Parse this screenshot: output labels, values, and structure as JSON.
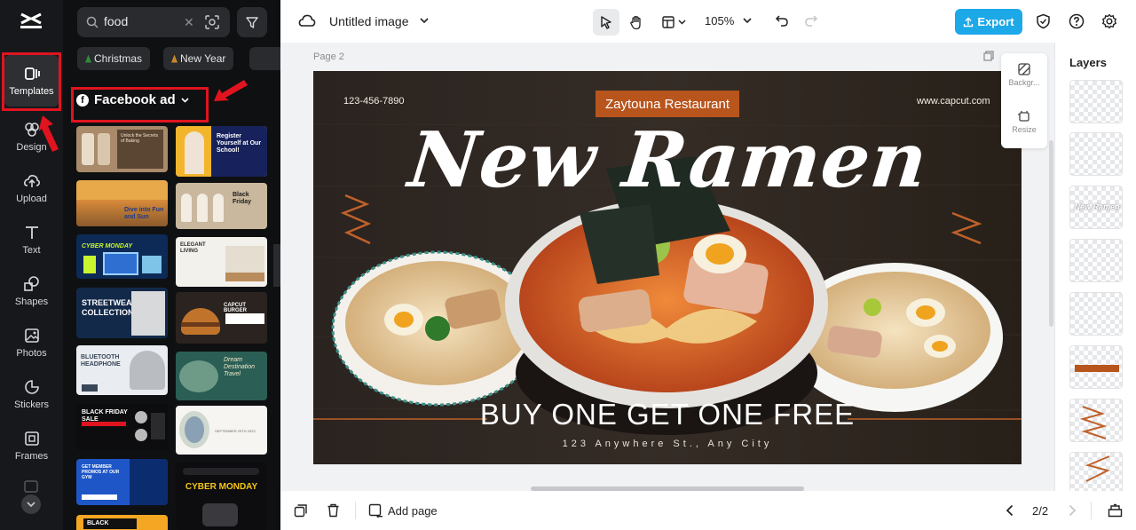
{
  "rail": {
    "items": [
      {
        "label": "Templates",
        "icon": "templates-icon"
      },
      {
        "label": "Design",
        "icon": "design-icon"
      },
      {
        "label": "Upload",
        "icon": "upload-icon"
      },
      {
        "label": "Text",
        "icon": "text-icon"
      },
      {
        "label": "Shapes",
        "icon": "shapes-icon"
      },
      {
        "label": "Photos",
        "icon": "photos-icon"
      },
      {
        "label": "Stickers",
        "icon": "stickers-icon"
      },
      {
        "label": "Frames",
        "icon": "frames-icon"
      }
    ]
  },
  "panel": {
    "search_value": "food",
    "chips": [
      "Christmas",
      "New Year"
    ],
    "category": "Facebook ad",
    "thumbnails": [
      "Unlock the Secrets of Baking",
      "Register Yourself at Our School!",
      "Dive into Fun and Sun",
      "Black Friday",
      "CYBER MONDAY",
      "ELEGANT LIVING",
      "STREETWEAR COLLECTION",
      "CAPCUT BURGER",
      "BLUETOOTH HEADPHONE",
      "Dream Destination Travel",
      "BLACK FRIDAY SALE",
      "SEPTEMBER 29TH 2023",
      "GET MEMBER PROMOS AT OUR GYM",
      "CYBER MONDAY",
      "BLACK"
    ]
  },
  "topbar": {
    "doc_title": "Untitled image",
    "zoom": "105%",
    "export_label": "Export"
  },
  "canvas": {
    "page_label": "Page 2",
    "phone": "123-456-7890",
    "website": "www.capcut.com",
    "restaurant": "Zaytouna Restaurant",
    "headline": "New Ramen",
    "offer": "BUY ONE GET ONE FREE",
    "address": "123 Anywhere St., Any City",
    "side_tools": [
      "Backgr...",
      "Resize"
    ]
  },
  "bottombar": {
    "add_page_label": "Add page",
    "page_count": "2/2"
  },
  "layers": {
    "title": "Layers",
    "thumb_text": "New Ramen"
  },
  "colors": {
    "accent": "#1da8e8",
    "highlight": "#e0141f",
    "restaurant_badge": "#b8551d",
    "rail_bg": "#17181b",
    "panel_bg": "#0f1012"
  }
}
